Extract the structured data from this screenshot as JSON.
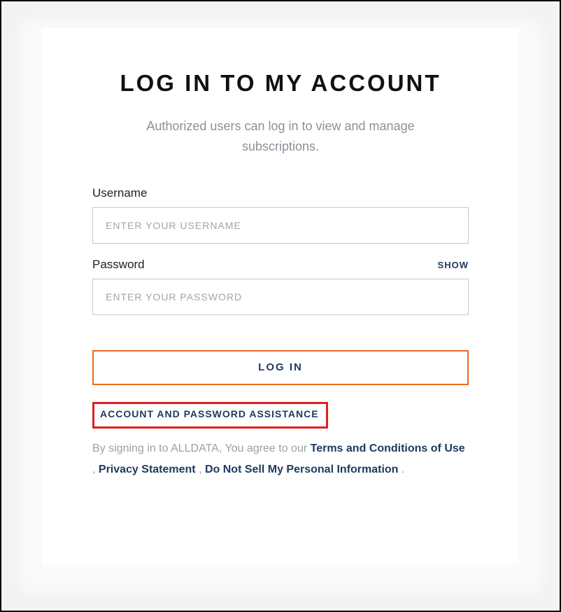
{
  "header": {
    "title": "LOG IN TO MY ACCOUNT",
    "subtitle": "Authorized users can log in to view and manage subscriptions."
  },
  "form": {
    "username": {
      "label": "Username",
      "placeholder": "ENTER YOUR USERNAME",
      "value": ""
    },
    "password": {
      "label": "Password",
      "placeholder": "ENTER YOUR PASSWORD",
      "value": "",
      "show_toggle": "SHOW"
    },
    "submit_label": "LOG IN"
  },
  "links": {
    "assistance": "ACCOUNT AND PASSWORD ASSISTANCE"
  },
  "legal": {
    "prefix": "By signing in to ALLDATA, You agree to our ",
    "terms": "Terms and Conditions of Use",
    "sep1": " , ",
    "privacy": "Privacy Statement",
    "sep2": " , ",
    "do_not_sell": "Do Not Sell My Personal Information",
    "suffix": " ."
  }
}
